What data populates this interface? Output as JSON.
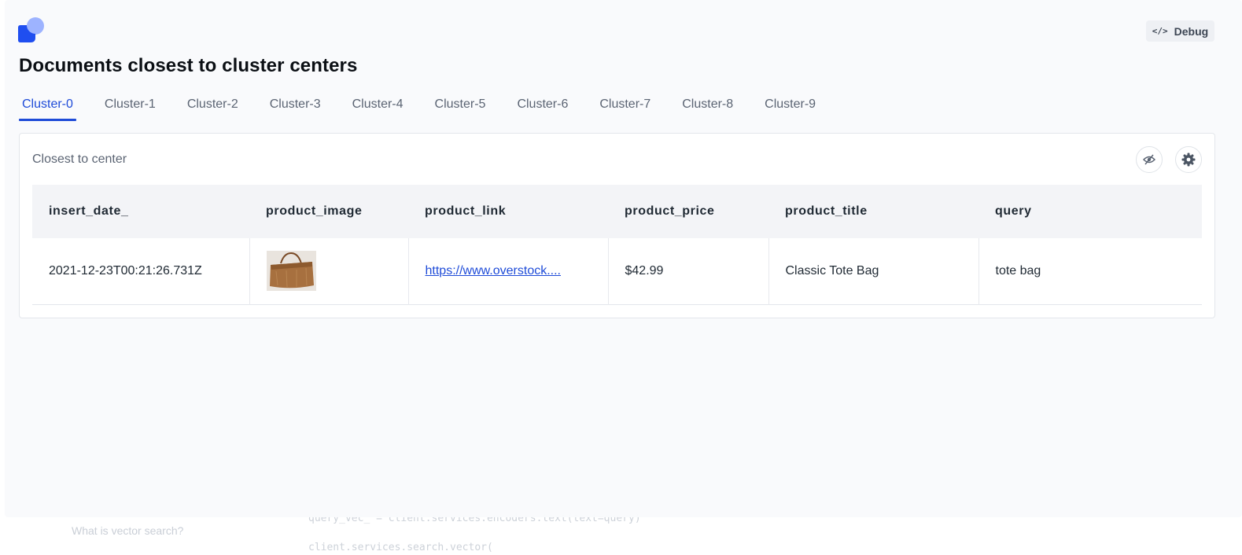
{
  "header": {
    "debug_label": "Debug",
    "title": "Documents closest to cluster centers"
  },
  "tabs": [
    {
      "label": "Cluster-0",
      "active": true
    },
    {
      "label": "Cluster-1",
      "active": false
    },
    {
      "label": "Cluster-2",
      "active": false
    },
    {
      "label": "Cluster-3",
      "active": false
    },
    {
      "label": "Cluster-4",
      "active": false
    },
    {
      "label": "Cluster-5",
      "active": false
    },
    {
      "label": "Cluster-6",
      "active": false
    },
    {
      "label": "Cluster-7",
      "active": false
    },
    {
      "label": "Cluster-8",
      "active": false
    },
    {
      "label": "Cluster-9",
      "active": false
    }
  ],
  "panel": {
    "title": "Closest to center",
    "columns": [
      "insert_date_",
      "product_image",
      "product_link",
      "product_price",
      "product_title",
      "query"
    ],
    "rows": [
      {
        "insert_date_": "2021-12-23T00:21:26.731Z",
        "product_link": "https://www.overstock....",
        "product_price": "$42.99",
        "product_title": "Classic Tote Bag",
        "query": "tote bag"
      }
    ]
  },
  "background": {
    "left_text": "What is vector search?",
    "code_line_1": "query_vec_ = client.services.encoders.text(text=query)",
    "code_line_2": "client.services.search.vector("
  },
  "colors": {
    "accent": "#1e4bd8",
    "logo_primary": "#1f4ef0",
    "logo_secondary": "#9db3ff"
  },
  "icons": {
    "debug": "code-icon",
    "eye": "eye-off-icon",
    "settings": "gear-icon"
  }
}
